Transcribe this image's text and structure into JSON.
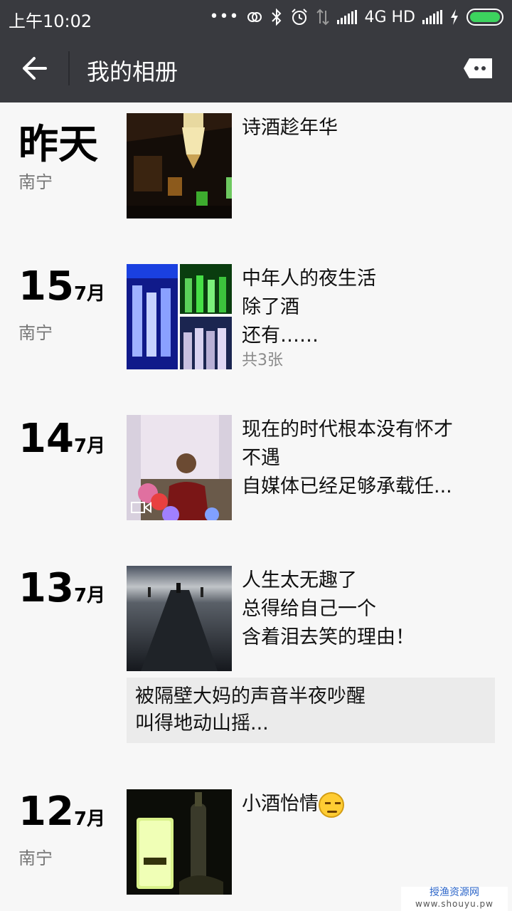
{
  "status_bar": {
    "time": "上午10:02",
    "network": "4G HD"
  },
  "nav": {
    "title": "我的相册"
  },
  "entries": [
    {
      "day": "昨天",
      "month": "",
      "location": "南宁",
      "text": "诗酒趁年华"
    },
    {
      "day": "15",
      "month": "7月",
      "location": "南宁",
      "text": "中年人的夜生活\n除了酒\n还有……",
      "count": "共3张"
    },
    {
      "day": "14",
      "month": "7月",
      "location": "",
      "text": "现在的时代根本没有怀才\n不遇\n自媒体已经足够承载任..."
    },
    {
      "day": "13",
      "month": "7月",
      "location": "",
      "text": "人生太无趣了\n总得给自己一个\n含着泪去笑的理由！",
      "share": "被隔壁大妈的声音半夜吵醒\n叫得地动山摇..."
    },
    {
      "day": "12",
      "month": "7月",
      "location": "南宁",
      "text": "小酒怡情"
    }
  ],
  "watermark": {
    "line1": "授渔资源网",
    "line2": "www.shouyu.pw"
  },
  "icons": {
    "back": "arrow-left-icon",
    "more": "more-icon",
    "video": "video-icon",
    "emoji": "smirk-emoji-icon"
  }
}
